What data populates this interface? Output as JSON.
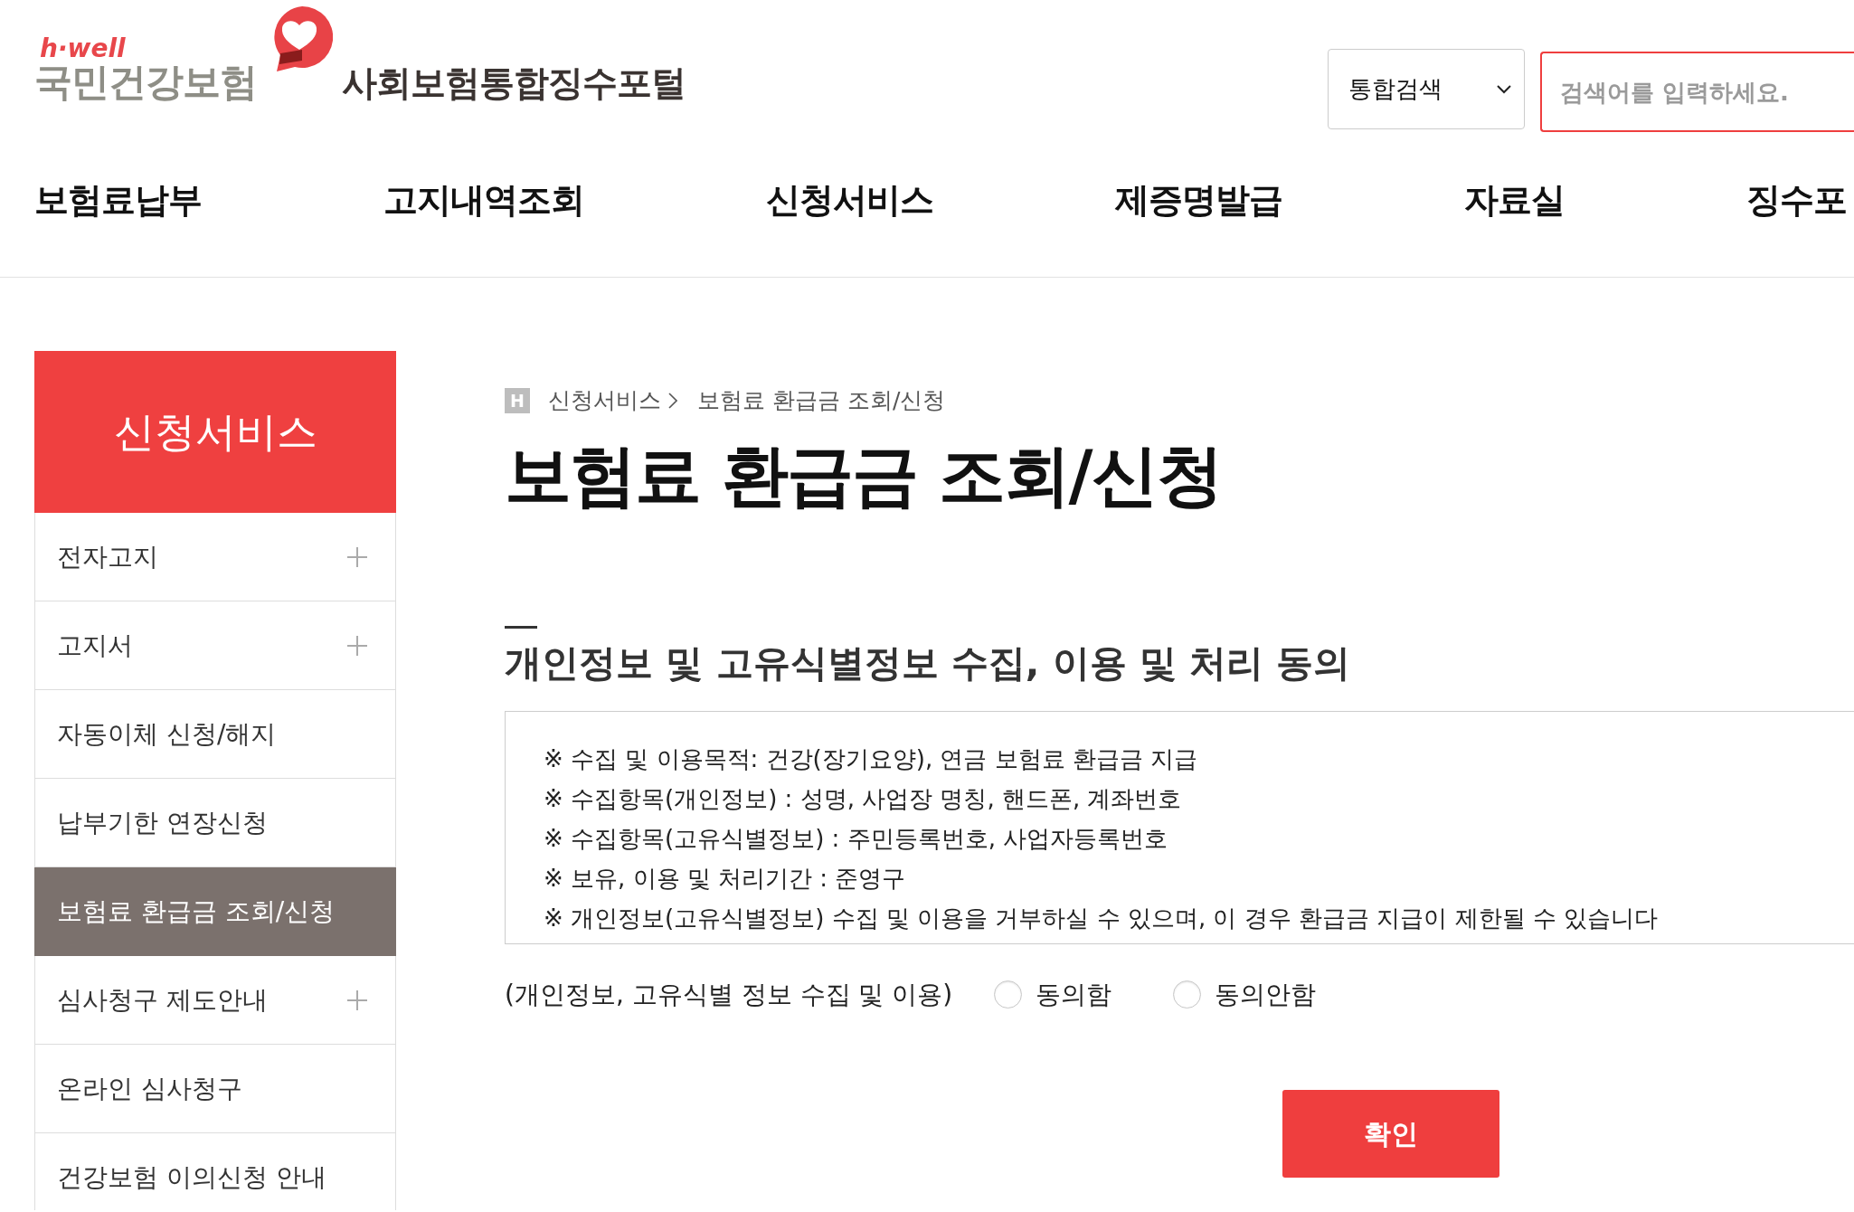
{
  "header": {
    "logo": {
      "tagline": "h·well",
      "name": "국민건강보험"
    },
    "portal_title": "사회보험통합징수포털",
    "search": {
      "scope": "통합검색",
      "placeholder": "검색어를 입력하세요."
    }
  },
  "main_nav": [
    "보험료납부",
    "고지내역조회",
    "신청서비스",
    "제증명발급",
    "자료실",
    "징수포"
  ],
  "sidebar": {
    "title": "신청서비스",
    "items": [
      {
        "label": "전자고지",
        "expandable": true,
        "selected": false
      },
      {
        "label": "고지서",
        "expandable": true,
        "selected": false
      },
      {
        "label": "자동이체 신청/해지",
        "expandable": false,
        "selected": false
      },
      {
        "label": "납부기한 연장신청",
        "expandable": false,
        "selected": false
      },
      {
        "label": "보험료 환급금 조회/신청",
        "expandable": false,
        "selected": true
      },
      {
        "label": "심사청구 제도안내",
        "expandable": true,
        "selected": false
      },
      {
        "label": "온라인 심사청구",
        "expandable": false,
        "selected": false
      },
      {
        "label": "건강보험 이의신청 안내",
        "expandable": false,
        "selected": false
      }
    ]
  },
  "breadcrumb": {
    "home": "H",
    "items": [
      "신청서비스",
      "보험료 환급금 조회/신청"
    ]
  },
  "page_title": "보험료 환급금 조회/신청",
  "consent_section": {
    "title": "개인정보 및 고유식별정보 수집, 이용 및 처리 동의",
    "notice": [
      "※ 수집 및 이용목적: 건강(장기요양), 연금 보험료 환급금 지급",
      "※ 수집항목(개인정보) : 성명, 사업장 명칭, 핸드폰, 계좌번호",
      "※ 수집항목(고유식별정보) : 주민등록번호, 사업자등록번호",
      "※ 보유, 이용 및 처리기간 : 준영구",
      "※ 개인정보(고유식별정보) 수집 및 이용을 거부하실 수 있으며, 이 경우 환급금 지급이 제한될 수 있습니다"
    ],
    "question": "(개인정보, 고유식별 정보 수집 및 이용)",
    "options": [
      {
        "label": "동의함",
        "selected": false
      },
      {
        "label": "동의안함",
        "selected": false
      }
    ],
    "confirm_button": "확인"
  }
}
